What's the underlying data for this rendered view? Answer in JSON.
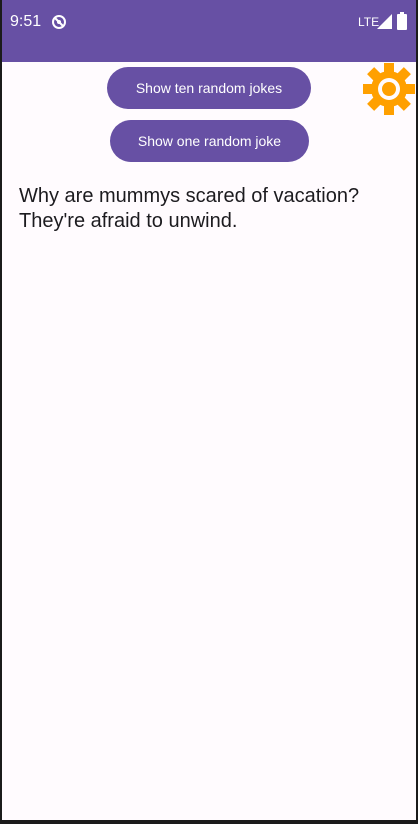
{
  "status_bar": {
    "time": "9:51",
    "app_icon": "no-sync-icon",
    "network": "LTE",
    "signal_icon": "signal-icon",
    "battery_icon": "battery-icon"
  },
  "buttons": {
    "ten_jokes_label": "Show ten random jokes",
    "one_joke_label": "Show one random joke",
    "settings_icon": "gear-icon"
  },
  "joke": {
    "setup": "Why are mummys scared of vacation?",
    "punchline": "They're afraid to unwind."
  },
  "colors": {
    "primary": "#6750a4",
    "background": "#fffbfe",
    "settings_icon": "#ffa000",
    "text": "#1c1b1f"
  }
}
